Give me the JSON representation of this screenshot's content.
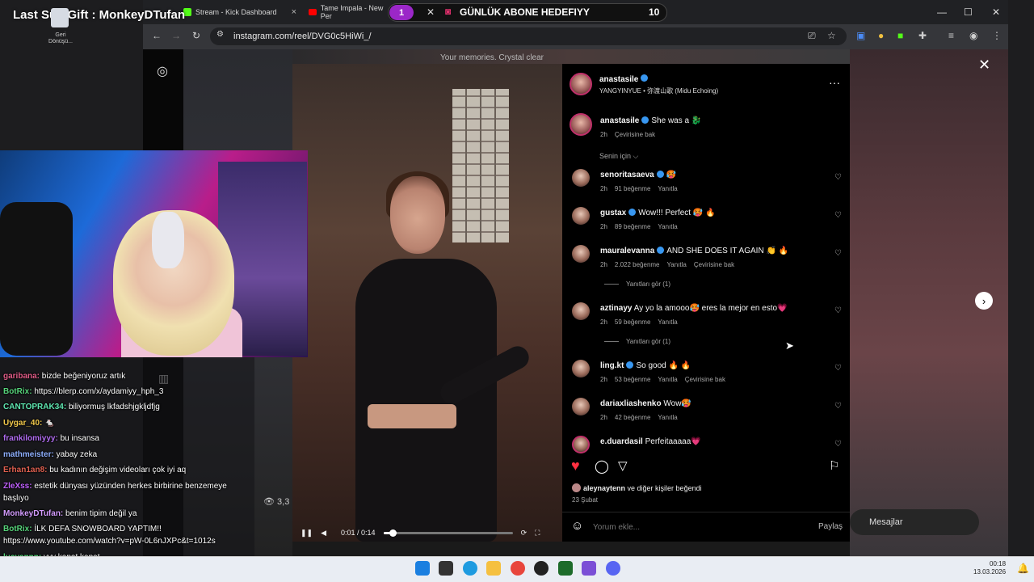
{
  "stream": {
    "gift_title": "Last Sub Gift : MonkeyDTufan",
    "sub_goal": {
      "count_left": "1",
      "title": "GÜNLÜK ABONE HEDEFIYY",
      "count_right": "10"
    },
    "desktop_icon_label": "Geri Dönüşü..."
  },
  "browser": {
    "tabs": [
      {
        "title": "Stream - Kick Dashboard",
        "close": "×"
      },
      {
        "title": "Tame Impala - New Per",
        "close": "×"
      }
    ],
    "url": "instagram.com/reel/DVG0c5HiWi_/",
    "window_controls": {
      "minimize": "—",
      "maximize": "☐",
      "close": "✕"
    }
  },
  "video": {
    "watermark": "Your memories. Crystal clear",
    "time": "0:01 / 0:14",
    "progress": 0.07,
    "view_count": "3,3"
  },
  "post": {
    "author": "anastasile",
    "audio": "YANGYINYUE • 弥渡山歌 (Midu Echoing)",
    "caption_user": "anastasile",
    "caption_text": "She was a 🐉",
    "caption_time": "2h",
    "caption_translate": "Çevirisine bak",
    "sort_label": "Senin için ⌵",
    "comments": [
      {
        "user": "senoritasaeva",
        "verified": true,
        "text": "🥵",
        "time": "2h",
        "likes": "91 beğenme",
        "reply": "Yanıtla",
        "translate": ""
      },
      {
        "user": "gustax",
        "verified": true,
        "text": "Wow!!! Perfect 🥵 🔥",
        "time": "2h",
        "likes": "89 beğenme",
        "reply": "Yanıtla",
        "translate": ""
      },
      {
        "user": "mauralevanna",
        "verified": true,
        "text": "AND SHE DOES IT AGAIN 👏 🔥",
        "time": "2h",
        "likes": "2.022 beğenme",
        "reply": "Yanıtla",
        "translate": "Çevirisine bak"
      },
      {
        "user": "aztinayy",
        "verified": false,
        "text": "Ay yo la amooo🥵 eres la mejor en esto💗",
        "time": "2h",
        "likes": "59 beğenme",
        "reply": "Yanıtla",
        "translate": ""
      },
      {
        "user": "ling.kt",
        "verified": true,
        "text": "So good 🔥 🔥",
        "time": "2h",
        "likes": "53 beğenme",
        "reply": "Yanıtla",
        "translate": "Çevirisine bak"
      },
      {
        "user": "dariaxliashenko",
        "verified": false,
        "text": "Wow🥵",
        "time": "2h",
        "likes": "42 beğenme",
        "reply": "Yanıtla",
        "translate": ""
      },
      {
        "user": "e.duardasil",
        "verified": false,
        "text": "Perfeitaaaaa💗",
        "time": "",
        "likes": "",
        "reply": "",
        "translate": ""
      }
    ],
    "view_replies_1": "Yanıtları gör (1)",
    "view_replies_2": "Yanıtları gör (1)",
    "liked_by_user": "aleynaytenn",
    "liked_by_rest": " ve diğer kişiler beğendi",
    "date": "23 Şubat",
    "comment_placeholder": "Yorum ekle...",
    "share_label": "Paylaş",
    "messages_label": "Mesajlar"
  },
  "chat": [
    {
      "name": "garibana:",
      "color": "#e05b86",
      "text": " bizde beğeniyoruz artık"
    },
    {
      "name": "BotRix:",
      "color": "#56d37a",
      "text": " https://blerp.com/x/aydamiyy_hph_3"
    },
    {
      "name": "CANTOPRAK34:",
      "color": "#5ee6b0",
      "text": " biliyormuş lkfadshjgkljdfjg"
    },
    {
      "name": "Uygar_40:",
      "color": "#f2c94c",
      "text": " 🐁"
    },
    {
      "name": "frankilomiyyy:",
      "color": "#b06cf0",
      "text": " bu insansa"
    },
    {
      "name": "mathmeister:",
      "color": "#8fb0ff",
      "text": " yabay zeka"
    },
    {
      "name": "Erhan1an8:",
      "color": "#e06050",
      "text": " bu kadının değişim videoları çok iyi aq"
    },
    {
      "name": "ZleXss:",
      "color": "#c060ff",
      "text": " estetik dünyası yüzünden herkes birbirine benzemeye"
    },
    {
      "name": "",
      "color": "#fff",
      "text": "başlıyo"
    },
    {
      "name": "MonkeyDTufan:",
      "color": "#d49cff",
      "text": " benim tipim değil ya"
    },
    {
      "name": "BotRix:",
      "color": "#56d37a",
      "text": " İLK DEFA SNOWBOARD YAPTIM!!"
    },
    {
      "name": "",
      "color": "#fff",
      "text": "https://www.youtube.com/watch?v=pW-0L6nJXPc&t=1012s"
    },
    {
      "name": "lucyannn:",
      "color": "#56d37a",
      "text": " yyy kapat kapat"
    }
  ],
  "taskbar": {
    "time": "00:18",
    "date": "13.03.2026"
  },
  "colors": {
    "accent_like": "#ff3040",
    "verified": "#3897f0",
    "kick_green": "#53fc18",
    "sub_purple": "#9b27c8"
  }
}
